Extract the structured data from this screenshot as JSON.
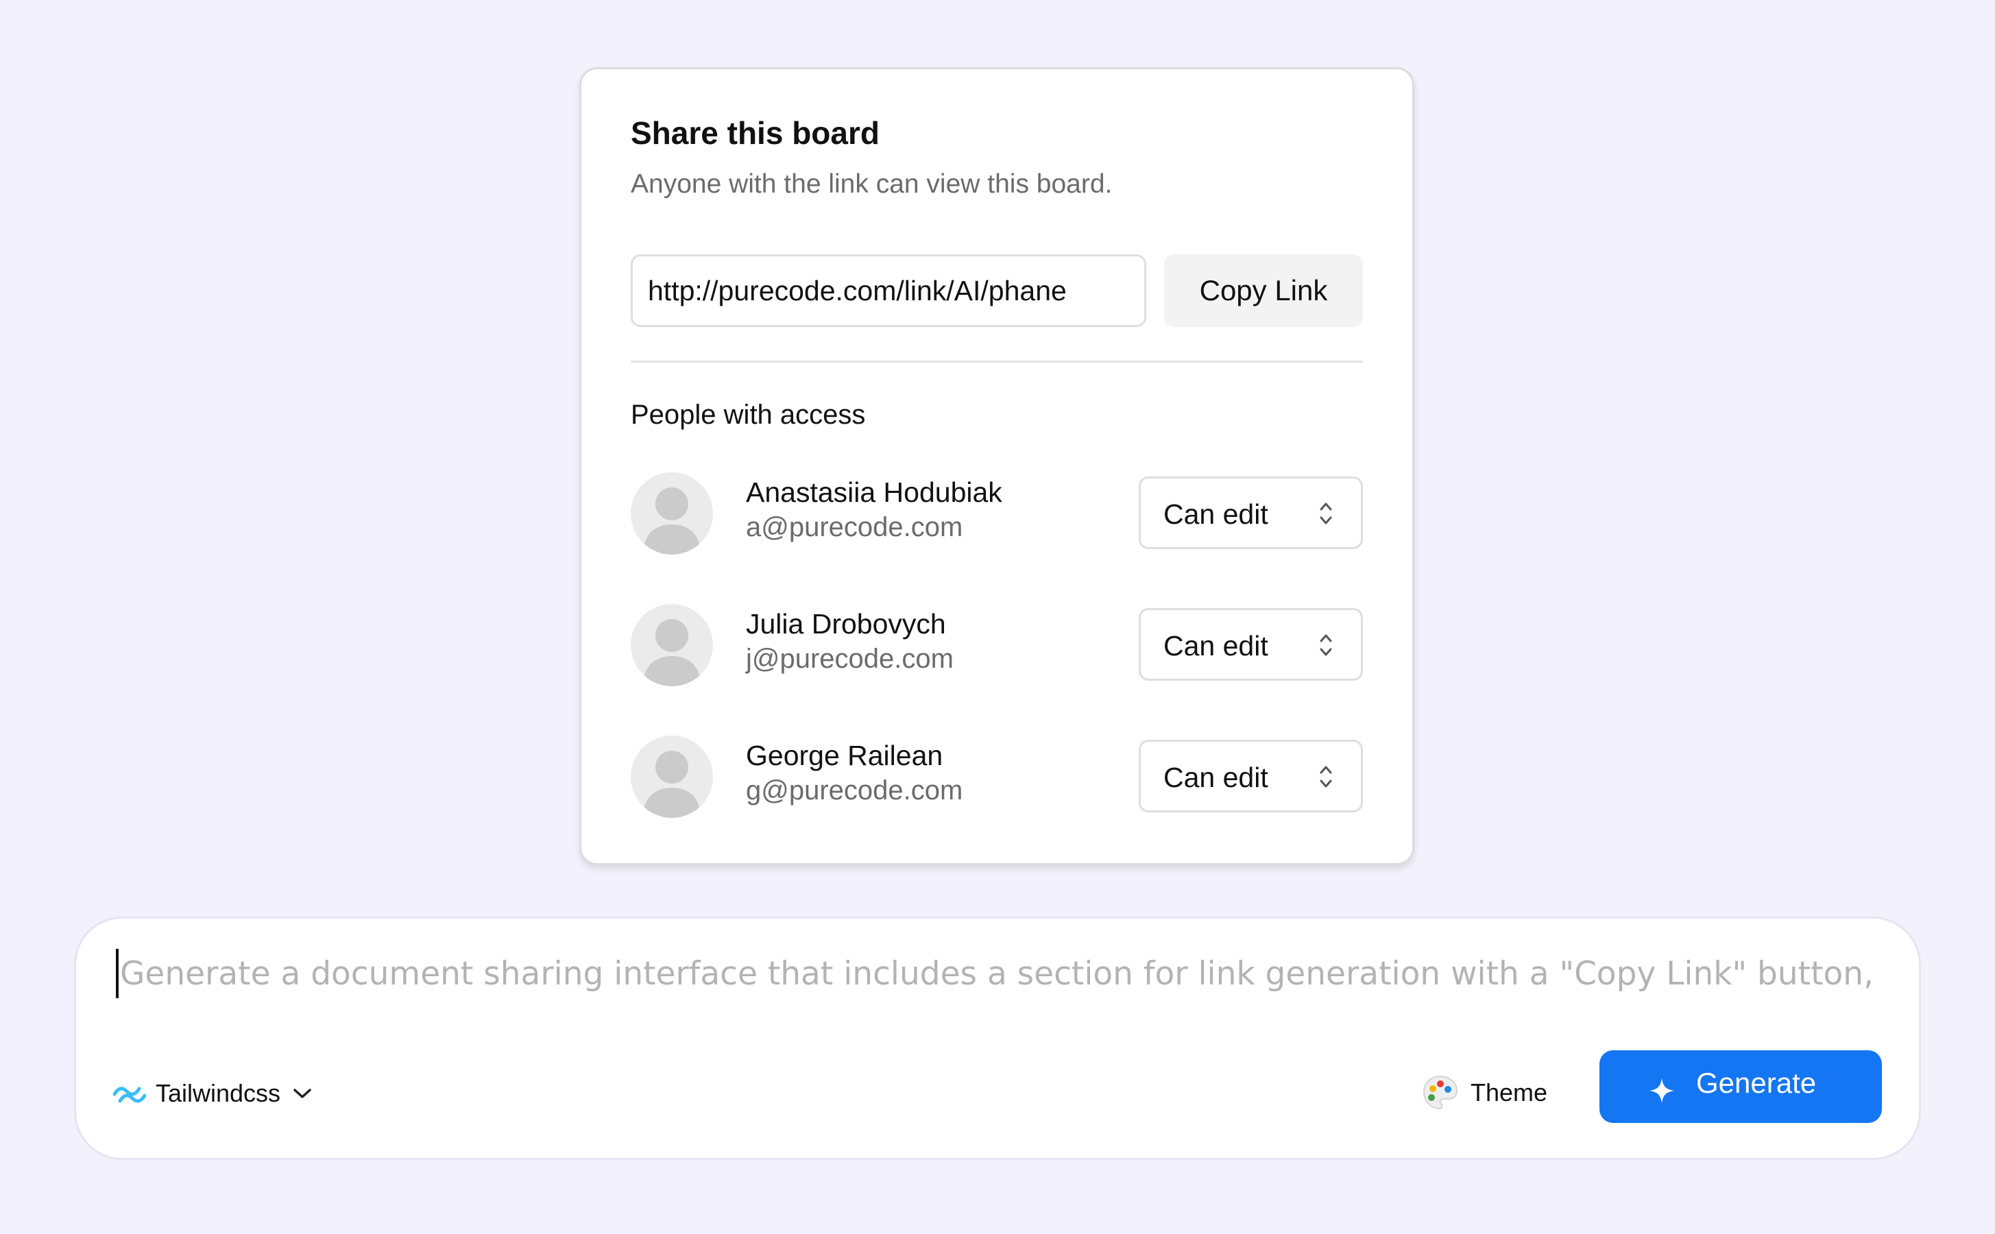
{
  "share_dialog": {
    "title": "Share this board",
    "subtitle": "Anyone with the link can view this board.",
    "link_value": "http://purecode.com/link/AI/phane",
    "copy_button_label": "Copy Link",
    "section_heading": "People with access",
    "people": [
      {
        "name": "Anastasiia Hodubiak",
        "email": "a@purecode.com",
        "permission": "Can edit"
      },
      {
        "name": "Julia Drobovych",
        "email": "j@purecode.com",
        "permission": "Can edit"
      },
      {
        "name": "George Railean",
        "email": "g@purecode.com",
        "permission": "Can edit"
      }
    ]
  },
  "prompt_bar": {
    "placeholder": "Generate a document sharing interface that includes a section for link generation with a \"Copy Link\" button, and a s",
    "framework_label": "Tailwindcss",
    "theme_label": "Theme",
    "generate_label": "Generate"
  },
  "colors": {
    "page_background": "#f3f1fc",
    "accent": "#1476f2",
    "muted_text": "#6b6b6b",
    "avatar_background": "#ebebeb",
    "avatar_figure": "#cbcbcb"
  }
}
